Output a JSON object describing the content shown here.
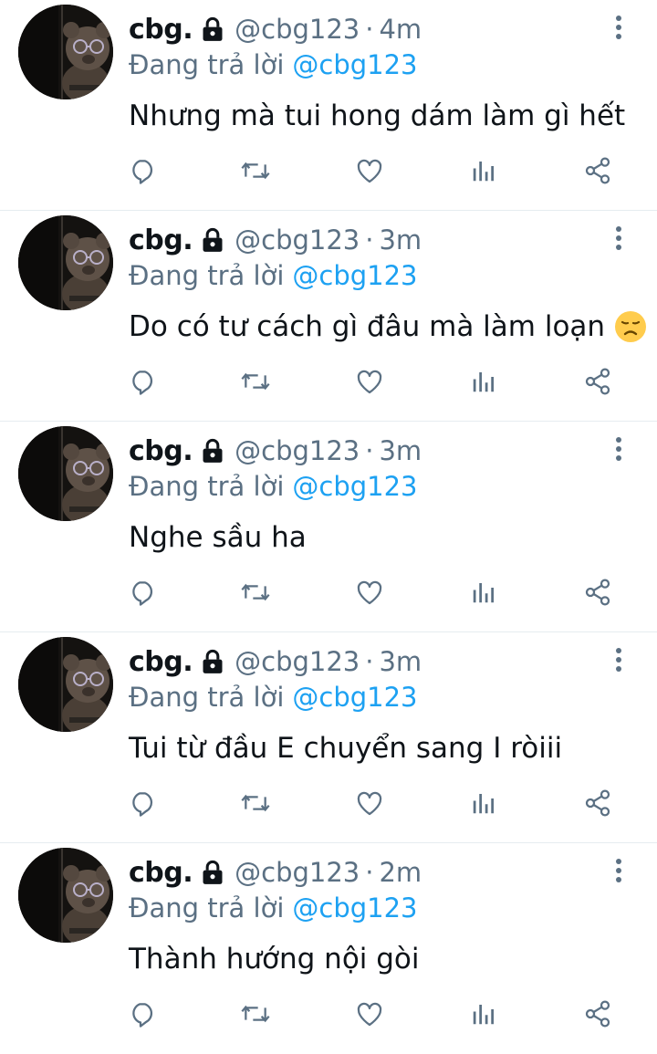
{
  "colors": {
    "text": "#0f1419",
    "secondary": "#5b7083",
    "link": "#1da1f2",
    "divider": "#e6ecf0"
  },
  "icons": {
    "lock": "lock-icon",
    "more": "more-vertical-icon",
    "reply": "reply-icon",
    "retweet": "retweet-icon",
    "like": "heart-icon",
    "stats": "analytics-icon",
    "share": "share-icon",
    "emoji": "disappointed-face-emoji"
  },
  "tweets": [
    {
      "name": "cbg.",
      "handle": "@cbg123",
      "separator": "·",
      "time": "4m",
      "reply_prefix": "Đang trả lời",
      "reply_to": "@cbg123",
      "text": "Nhưng mà tui hong dám làm gì hết",
      "emoji": ""
    },
    {
      "name": "cbg.",
      "handle": "@cbg123",
      "separator": "·",
      "time": "3m",
      "reply_prefix": "Đang trả lời",
      "reply_to": "@cbg123",
      "text": "Do có tư cách gì đâu mà làm loạn",
      "emoji": "disappointed-face"
    },
    {
      "name": "cbg.",
      "handle": "@cbg123",
      "separator": "·",
      "time": "3m",
      "reply_prefix": "Đang trả lời",
      "reply_to": "@cbg123",
      "text": "Nghe sầu ha",
      "emoji": ""
    },
    {
      "name": "cbg.",
      "handle": "@cbg123",
      "separator": "·",
      "time": "3m",
      "reply_prefix": "Đang trả lời",
      "reply_to": "@cbg123",
      "text": "Tui từ đầu E chuyển sang I ròiii",
      "emoji": ""
    },
    {
      "name": "cbg.",
      "handle": "@cbg123",
      "separator": "·",
      "time": "2m",
      "reply_prefix": "Đang trả lời",
      "reply_to": "@cbg123",
      "text": "Thành hướng nội gòi",
      "emoji": ""
    }
  ]
}
